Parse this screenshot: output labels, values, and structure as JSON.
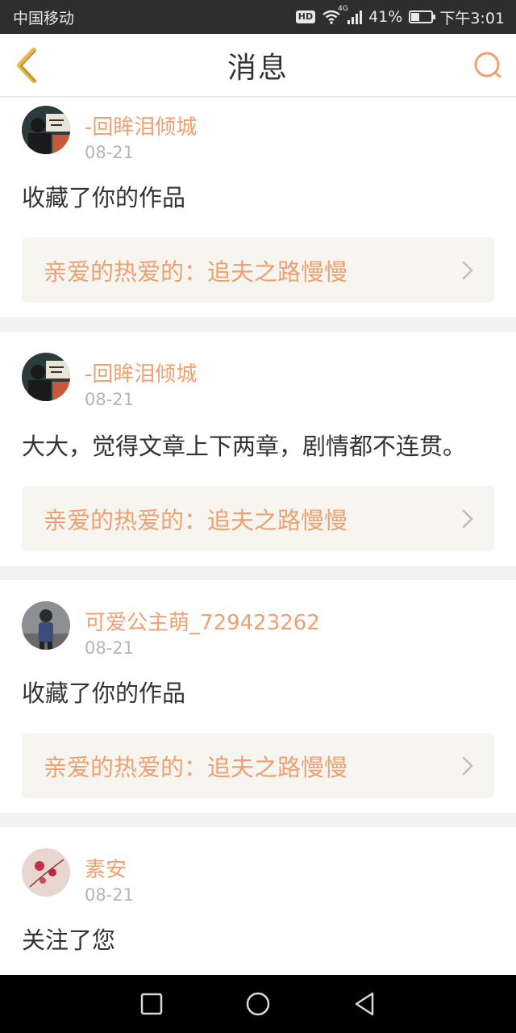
{
  "status_bar": {
    "carrier": "中国移动",
    "hd": "HD",
    "network": "4G",
    "battery": "41%",
    "battery_level": 0.41,
    "time": "下午3:01"
  },
  "header": {
    "title": "消息",
    "back_icon": "chevron-left-icon",
    "search_icon": "search-icon"
  },
  "colors": {
    "accent": "#f0a070",
    "text": "#333333",
    "muted": "#b5b5b5",
    "link_bg": "#f6f5f0"
  },
  "messages": [
    {
      "user": "-回眸泪倾城",
      "date": "08-21",
      "text": "收藏了你的作品",
      "work": "亲爱的热爱的：追夫之路慢慢"
    },
    {
      "user": "-回眸泪倾城",
      "date": "08-21",
      "text": "大大，觉得文章上下两章，剧情都不连贯。",
      "work": "亲爱的热爱的：追夫之路慢慢"
    },
    {
      "user": "可爱公主萌_729423262",
      "date": "08-21",
      "text": "收藏了你的作品",
      "work": "亲爱的热爱的：追夫之路慢慢"
    },
    {
      "user": "素安",
      "date": "08-21",
      "text": "关注了您"
    }
  ],
  "system_nav": {
    "recents_icon": "square-icon",
    "home_icon": "circle-icon",
    "back_icon": "triangle-back-icon"
  }
}
